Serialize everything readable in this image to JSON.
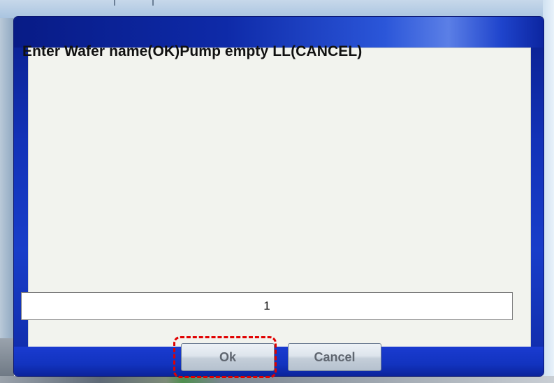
{
  "dialog": {
    "prompt": "Enter Wafer name(OK)Pump empty LL(CANCEL)",
    "input_value": "1",
    "ok_label": "Ok",
    "cancel_label": "Cancel"
  },
  "colors": {
    "frame": "#1232b8",
    "body": "#f2f3ee",
    "highlight": "#e00000"
  }
}
